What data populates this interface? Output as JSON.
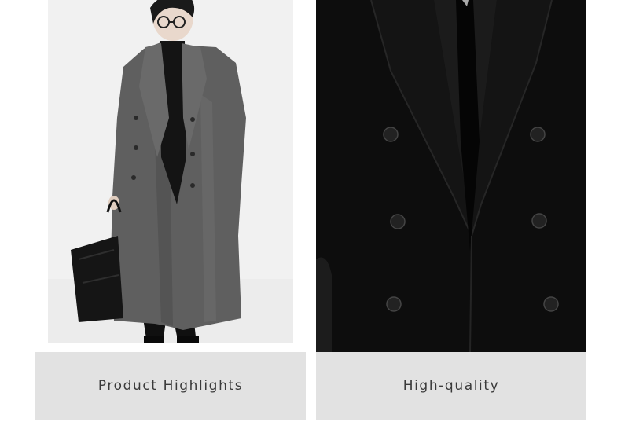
{
  "cards": [
    {
      "caption": "Product Highlights",
      "image": "man-in-grey-long-coat-with-black-bag"
    },
    {
      "caption": "High-quality",
      "image": "black-double-breasted-coat-closeup"
    }
  ],
  "colors": {
    "caption_bg": "#e2e2e2",
    "caption_text": "#3a3a3a",
    "studio_bg": "#f1f1f1",
    "grey_coat": "#5f5f5f",
    "black_coat": "#0d0d0d"
  }
}
